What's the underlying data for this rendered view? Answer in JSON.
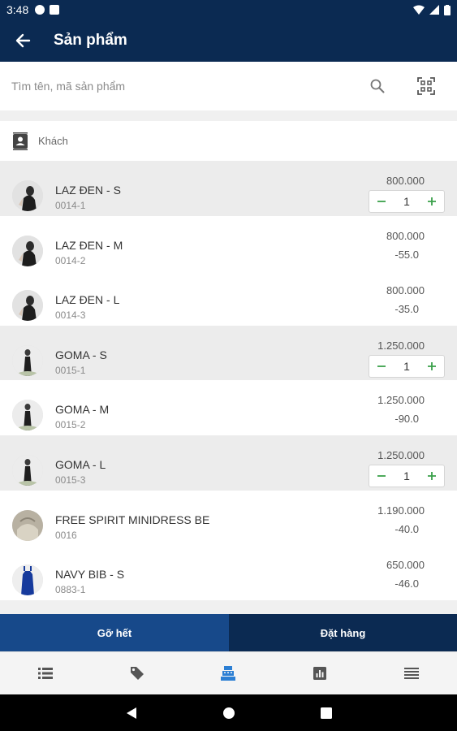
{
  "status_bar": {
    "time": "3:48"
  },
  "app_bar": {
    "title": "Sản phẩm",
    "back_icon": "arrow-left-icon"
  },
  "search": {
    "placeholder": "Tìm tên, mã sản phẩm",
    "value": ""
  },
  "customer": {
    "label": "Khách",
    "icon": "contact-card-icon"
  },
  "products": [
    {
      "name": "LAZ ĐEN - S",
      "code": "0014-1",
      "price": "800.000",
      "selected": true,
      "quantity": "1",
      "avatar": "woman"
    },
    {
      "name": "LAZ ĐEN - M",
      "code": "0014-2",
      "price": "800.000",
      "stock": "-55.0",
      "selected": false,
      "avatar": "woman"
    },
    {
      "name": "LAZ ĐEN - L",
      "code": "0014-3",
      "price": "800.000",
      "stock": "-35.0",
      "selected": false,
      "avatar": "woman"
    },
    {
      "name": "GOMA - S",
      "code": "0015-1",
      "price": "1.250.000",
      "selected": true,
      "quantity": "1",
      "avatar": "dress"
    },
    {
      "name": "GOMA - M",
      "code": "0015-2",
      "price": "1.250.000",
      "stock": "-90.0",
      "selected": false,
      "avatar": "dress"
    },
    {
      "name": "GOMA - L",
      "code": "0015-3",
      "price": "1.250.000",
      "selected": true,
      "quantity": "1",
      "avatar": "dress"
    },
    {
      "name": "FREE SPIRIT MINIDRESS BE",
      "code": "0016",
      "price": "1.190.000",
      "stock": "-40.0",
      "selected": false,
      "avatar": "beige"
    },
    {
      "name": "NAVY BIB - S",
      "code": "0883-1",
      "price": "650.000",
      "stock": "-46.0",
      "selected": false,
      "avatar": "navy"
    }
  ],
  "actions": {
    "clear_label": "Gỡ hết",
    "order_label": "Đặt hàng"
  },
  "bottom_nav": [
    {
      "icon": "list-icon",
      "active": false
    },
    {
      "icon": "tag-icon",
      "active": false
    },
    {
      "icon": "cash-register-icon",
      "active": true
    },
    {
      "icon": "report-chart-icon",
      "active": false
    },
    {
      "icon": "menu-icon",
      "active": false
    }
  ],
  "colors": {
    "primary": "#0b2a52",
    "secondary": "#17498a",
    "accent": "#3aa04a",
    "active_tab": "#2c7fd4"
  }
}
